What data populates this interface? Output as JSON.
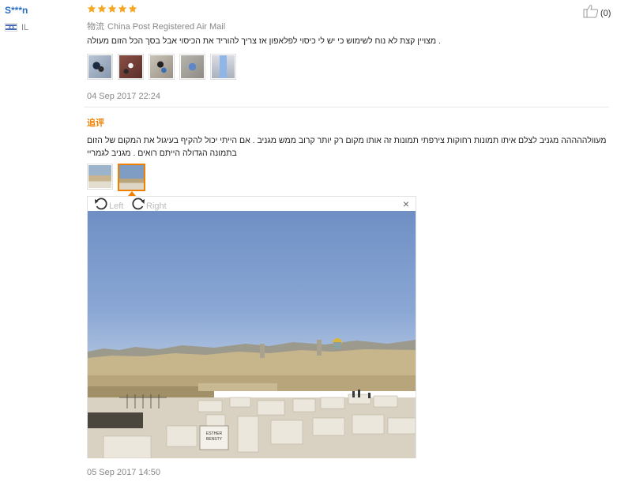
{
  "reviewer": {
    "name": "S***n",
    "country": "IL"
  },
  "rating": {
    "stars": 5,
    "max": 5,
    "color": "#f5a623"
  },
  "helpful": {
    "count": "(0)"
  },
  "logistics": {
    "label": "物流",
    "value": "China Post Registered Air Mail"
  },
  "review": {
    "text": ".  מצויין קצת לא נוח לשימוש כי יש לי כיסוי לפלאפון אז צריך להוריד את הכיסוי אבל בסך הכל הזום מעולה",
    "photo_count": 5,
    "date": "04 Sep 2017 22:24"
  },
  "followup": {
    "label": "追评",
    "text_line1": "מעוולההההה מגניב לצלם איתו תמונות רחוקות צירפתי תמונות זה אותו מקום רק יותר קרוב ממש מגניב . אם הייתי יכול להקיף בעיגול את המקום של הזום",
    "text_line2": "בתמונה הגדולה הייתם רואים . מגניב לגמריי",
    "photo_count": 2,
    "date": "05 Sep 2017 14:50"
  },
  "viewer": {
    "rotate_left": "Left",
    "rotate_right": "Right",
    "close": "×",
    "sign_text_1": "ESTHER",
    "sign_text_2": "BENSTY"
  }
}
